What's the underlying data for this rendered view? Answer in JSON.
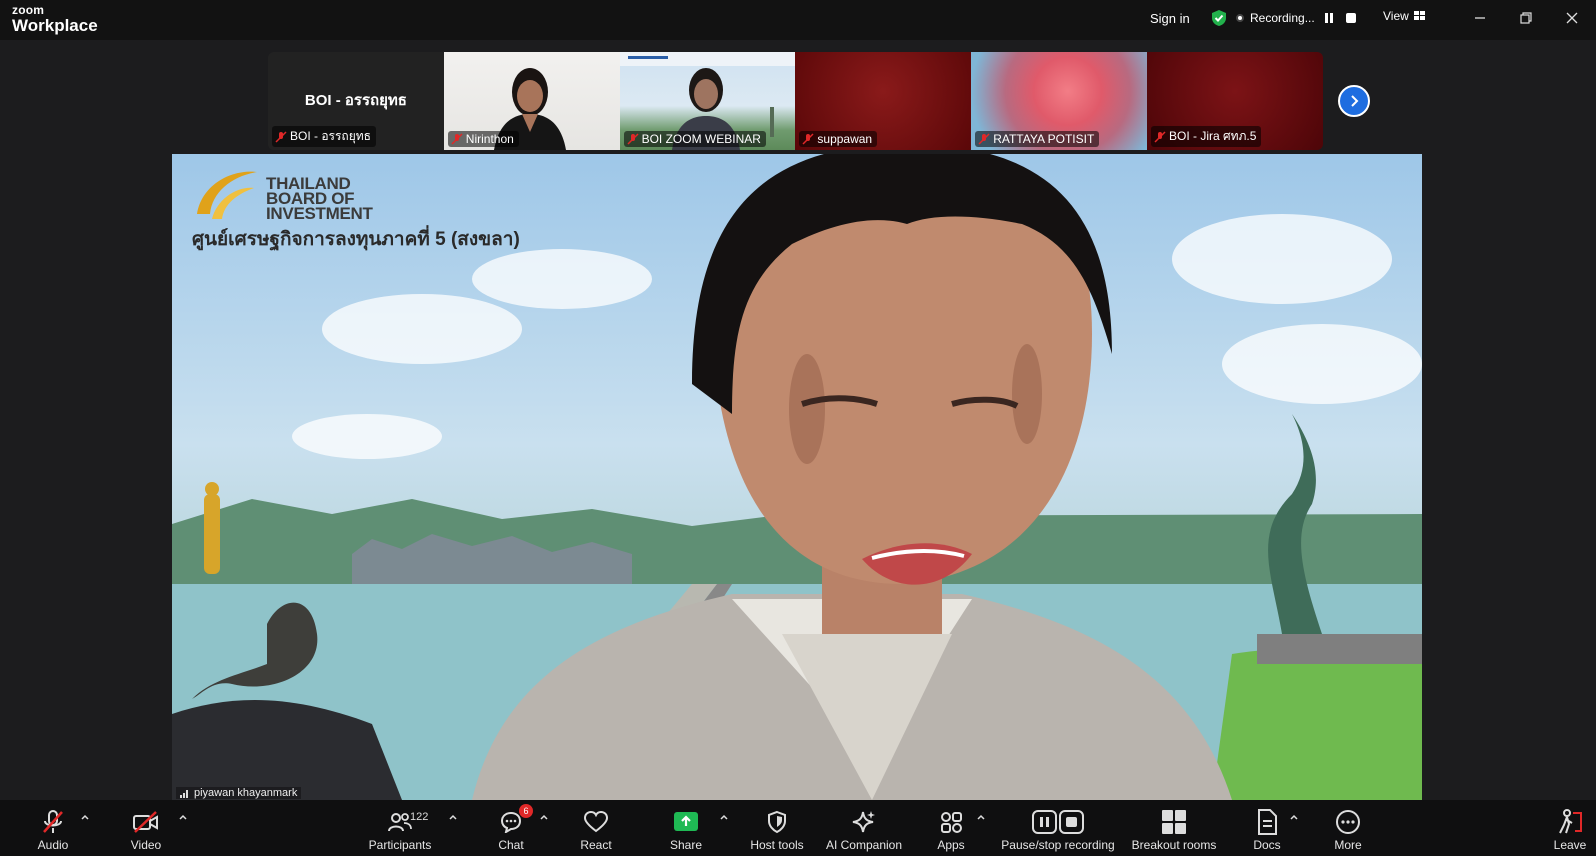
{
  "app": {
    "brand_top": "zoom",
    "brand_bottom": "Workplace"
  },
  "titlebar": {
    "sign_in": "Sign in",
    "recording": "Recording...",
    "view": "View"
  },
  "thumbnails": [
    {
      "name": "BOI - อรรถยุทธ",
      "display_name": "BOI - อรรถยุทธ",
      "type": "name-card"
    },
    {
      "name": "Nirinthon",
      "type": "video"
    },
    {
      "name": "BOI ZOOM WEBINAR",
      "type": "video"
    },
    {
      "name": "suppawan",
      "type": "video"
    },
    {
      "name": "RATTAYA POTISIT",
      "type": "video"
    },
    {
      "name": "BOI - Jira ศทภ.5",
      "type": "video"
    }
  ],
  "main": {
    "brand_line1": "THAILAND",
    "brand_line2": "BOARD OF",
    "brand_line3": "INVESTMENT",
    "subtitle": "ศูนย์เศรษฐกิจการลงทุนภาคที่ 5 (สงขลา)",
    "speaker": "piyawan khayanmark"
  },
  "toolbar": {
    "audio": "Audio",
    "video": "Video",
    "participants": "Participants",
    "participants_count": "122",
    "chat": "Chat",
    "chat_badge": "6",
    "react": "React",
    "share": "Share",
    "host_tools": "Host tools",
    "ai_companion": "AI Companion",
    "apps": "Apps",
    "pause_stop": "Pause/stop recording",
    "breakout": "Breakout rooms",
    "docs": "Docs",
    "more": "More",
    "leave": "Leave"
  },
  "colors": {
    "accent": "#1e6de0",
    "share_green": "#1fb954",
    "muted_red": "#e02828",
    "shield_green": "#22b14c"
  }
}
